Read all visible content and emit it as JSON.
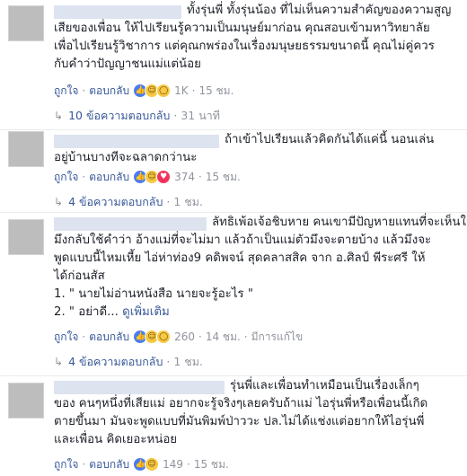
{
  "comments": [
    {
      "lines": [
        "ทั้งรุ่นพี่  ทั้งรุ่นน้อง  ที่ไม่เห็นความสำคัญของความสูญ",
        "เสียของเพื่อน  ให้ไปเรียนรู้ความเป็นมนุษย์มาก่อน  คุณสอบเข้ามหาวิทยาลัย",
        "เพื่อไปเรียนรู้วิชาการ  แต่คุณกพร่องในเรื่องมนุษยธรรมขนาดนี้  คุณไม่คู่ควร",
        "กับคำว่าปัญญาชนแม่แต่น้อย"
      ],
      "like": "ถูกใจ",
      "reply": "ตอบกลับ",
      "reaction_count": "1K",
      "time": "15 ชม.",
      "replies_label": "10 ข้อความตอบกลับ",
      "replies_time": "31 นาที"
    },
    {
      "lines": [
        "ถ้าเข้าไปเรียนแล้วคิดกันได้แค่นี้  นอนเล่น",
        "อยู่บ้านบางทีจะฉลาดกว่านะ"
      ],
      "like": "ถูกใจ",
      "reply": "ตอบกลับ",
      "reaction_count": "374",
      "time": "15 ชม.",
      "replies_label": "4 ข้อความตอบกลับ",
      "replies_time": "1 ชม."
    },
    {
      "lines": [
        "ลัทธิเพ้อเจ้อชิบหาย  คนเขามีปัญหายแทนที่จะเห็นใจ",
        "มึงกลับใช้คำว่า  อ้างแม่ที่จะไม่มา  แล้วถ้าเป็นแม่ตัวมึงจะตายบ้าง  แล้วมึงจะ",
        "พูดแบบนี้ไหมเหี้ย  ไอ่ห่าท่อง9  คดิพจน์  สุดคลาสสิค  จาก  อ.ศิลป์  พีระศรี  ให้",
        "ได้ก่อนสัส",
        "1.  \"  นายไม่อ่านหนังสือ  นายจะรู้อะไร  \"",
        "2.  \"  อย่าดี..."
      ],
      "more": "ดูเพิ่มเติม",
      "like": "ถูกใจ",
      "reply": "ตอบกลับ",
      "reaction_count": "260",
      "time": "14 ชม.",
      "edited": "มีการแก้ไข",
      "replies_label": "4 ข้อความตอบกลับ",
      "replies_time": "1 ชม."
    },
    {
      "lines": [
        "รุ่นพี่และเพื่อนทำเหมือนเป็นเรื่องเล็กๆ",
        "ของ  คนๆหนึ่งที่เสียแม่  อยากจะรู้จริงๆเลยครับถ้าแม่  ไอรุ่นพี่หรือเพื่อนนี้เกิด",
        "ตายขึ้นมา  มันจะพูดแบบที่มันพิมพ์ป่าววะ  ปล.ไม่ได้แช่งแต่อยากให้ไอรุ่นพี่",
        "และเพื่อน  คิดเยอะหน่อย"
      ],
      "like": "ถูกใจ",
      "reply": "ตอบกลับ",
      "reaction_count": "149",
      "time": "15 ชม."
    }
  ],
  "colors": {
    "link": "#385898",
    "meta": "#90949c",
    "text": "#1d2129",
    "name_blur": "#dde3ef"
  },
  "icons": {
    "reply_arrow": "reply-arrow-icon",
    "like": "like-reaction-icon",
    "haha": "haha-reaction-icon",
    "wow": "wow-reaction-icon",
    "love": "love-reaction-icon"
  }
}
